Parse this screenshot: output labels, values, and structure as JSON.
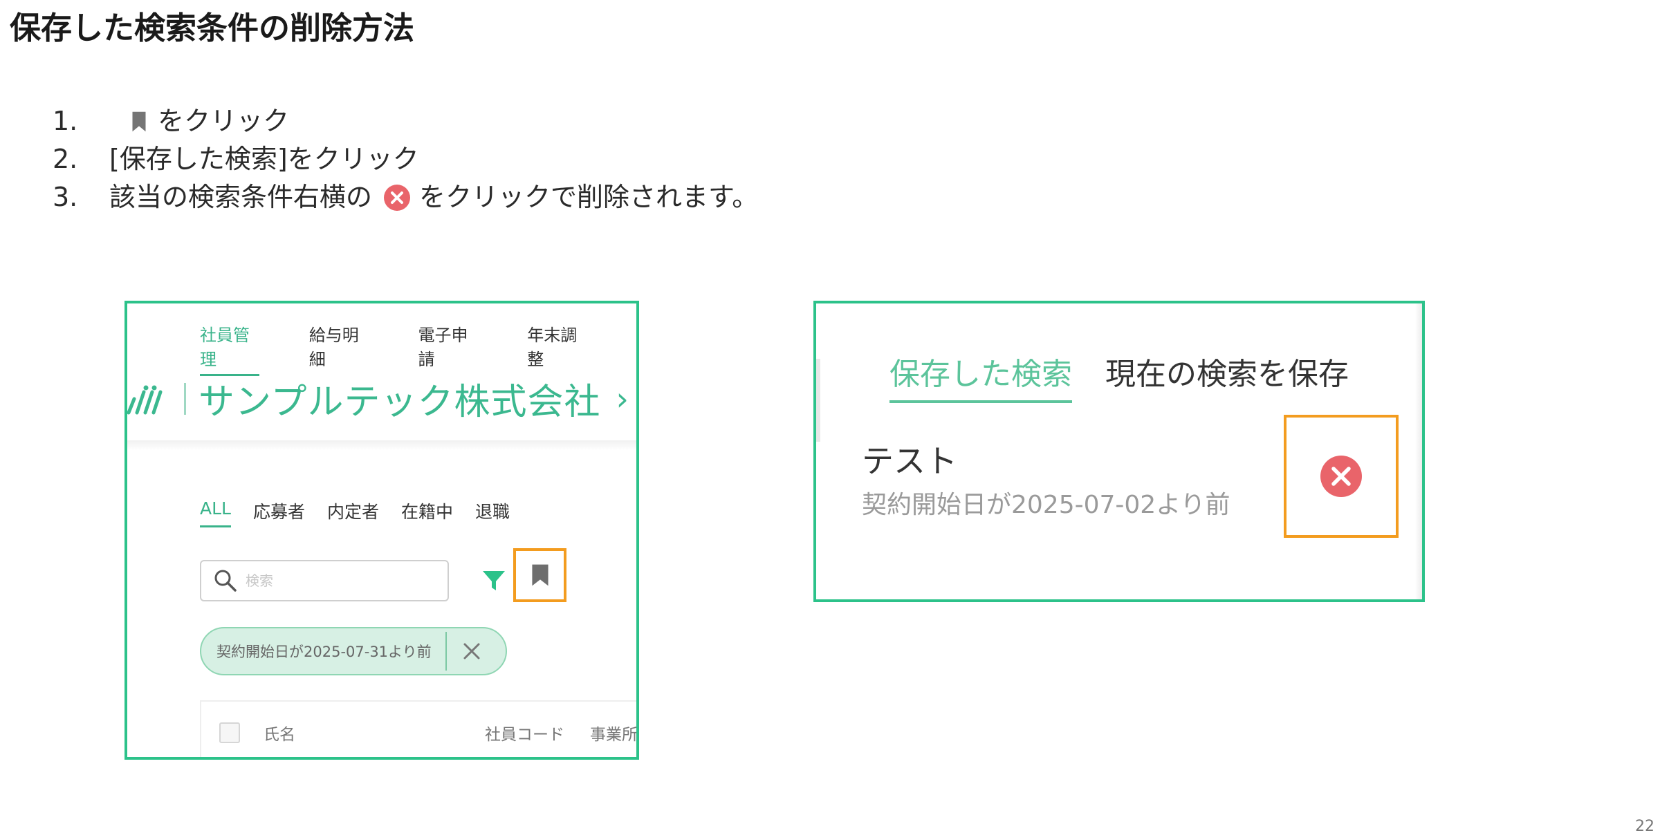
{
  "slide": {
    "title": "保存した検索条件の削除方法",
    "page_number": "22"
  },
  "steps": [
    {
      "number": "1.",
      "before": "",
      "after": "をクリック",
      "icon": "bookmark-icon"
    },
    {
      "number": "2.",
      "text": "[保存した検索]をクリック"
    },
    {
      "number": "3.",
      "before": "該当の検索条件右横の",
      "after": "をクリックで削除されます。",
      "icon": "close-circle-icon"
    }
  ],
  "left_panel": {
    "nav_tabs": [
      "社員管理",
      "給与明細",
      "電子申請",
      "年末調整"
    ],
    "company_name": "サンプルテック株式会社",
    "breadcrumb_chevron": "›",
    "status_tabs": [
      "ALL",
      "応募者",
      "内定者",
      "在籍中",
      "退職"
    ],
    "search_placeholder": "検索",
    "filter_chip_label": "契約開始日が2025-07-31より前",
    "table_columns": [
      "氏名",
      "社員コード",
      "事業所"
    ]
  },
  "right_panel": {
    "tabs": [
      "保存した検索",
      "現在の検索を保存"
    ],
    "saved_item_title": "テスト",
    "saved_item_description": "契約開始日が2025-07-02より前"
  },
  "colors": {
    "accent_green": "#2cc28a",
    "highlight_orange": "#f39c1f",
    "delete_red": "#e9646a"
  }
}
